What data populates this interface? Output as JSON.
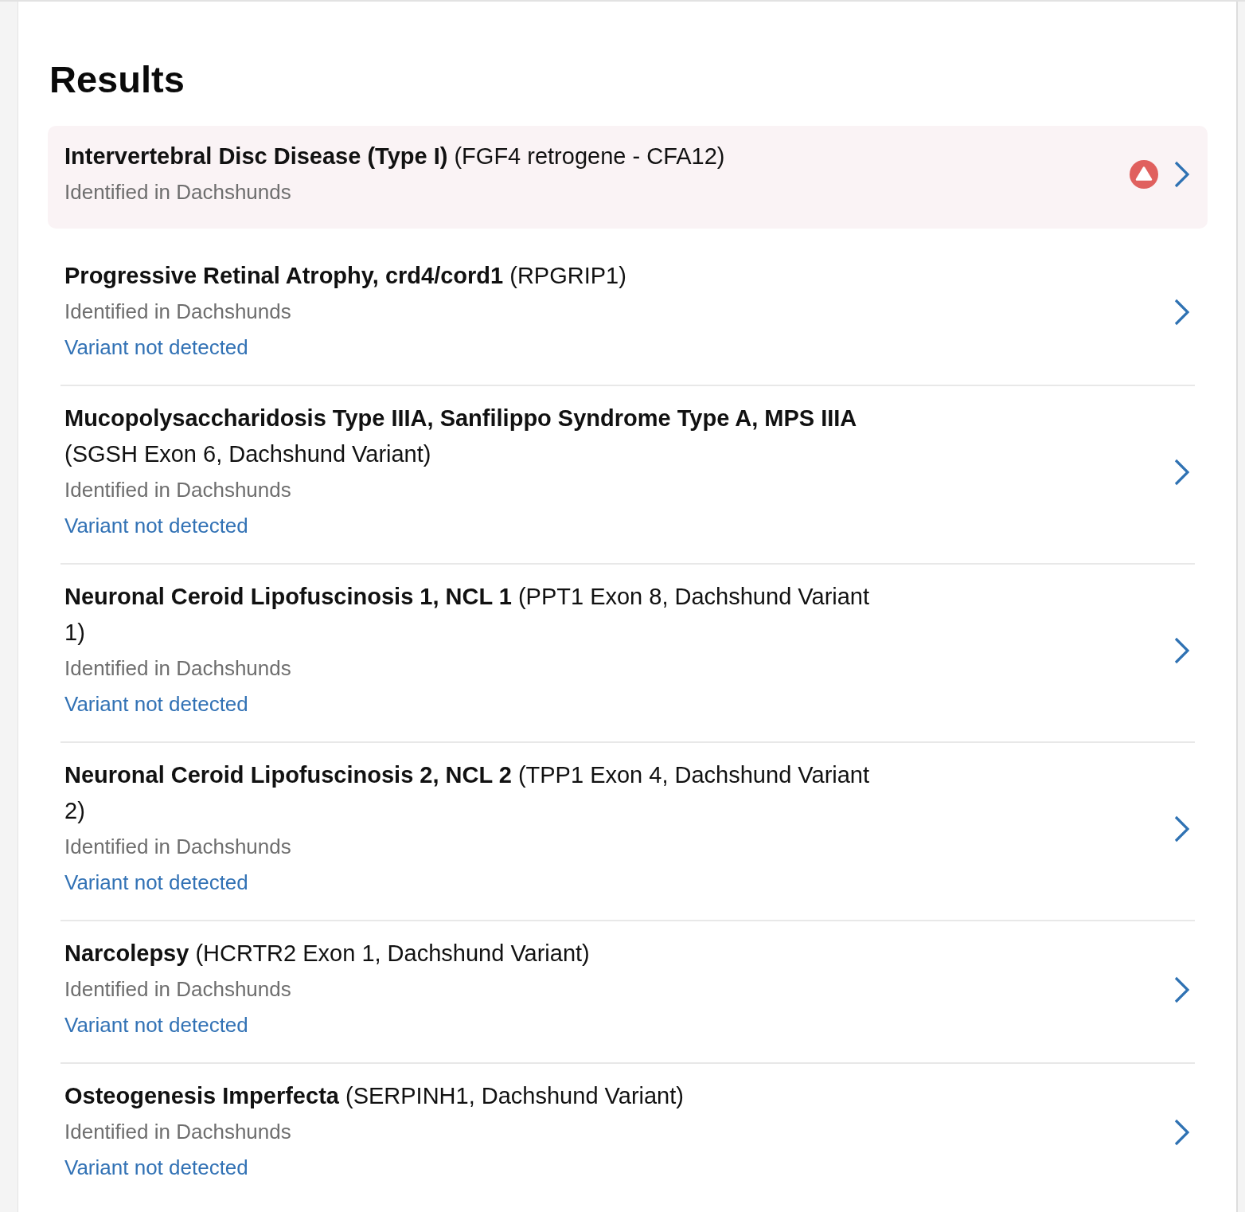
{
  "page": {
    "heading": "Results"
  },
  "results": [
    {
      "title": "**Intervertebral Disc Disease (Type I)** (FGF4 retrogene - CFA12)",
      "subtitle": "Identified in Dachshunds",
      "alert": true
    },
    {
      "title": "**Progressive Retinal Atrophy, crd4/cord1** (RPGRIP1)",
      "subtitle": "Identified in Dachshunds",
      "status": "Variant not detected",
      "alert": false
    },
    {
      "title": "**Mucopolysaccharidosis Type IIIA, Sanfilippo Syndrome Type A, MPS IIIA** (SGSH Exon 6, Dachshund Variant)",
      "subtitle": "Identified in Dachshunds",
      "status": "Variant not detected",
      "alert": false
    },
    {
      "title": "**Neuronal Ceroid Lipofuscinosis 1, NCL 1** (PPT1 Exon 8, Dachshund Variant 1)",
      "subtitle": "Identified in Dachshunds",
      "status": "Variant not detected",
      "alert": false
    },
    {
      "title": "**Neuronal Ceroid Lipofuscinosis 2, NCL 2** (TPP1 Exon 4, Dachshund Variant 2)",
      "subtitle": "Identified in Dachshunds",
      "status": "Variant not detected",
      "alert": false
    },
    {
      "title": "**Narcolepsy** (HCRTR2 Exon 1, Dachshund Variant)",
      "subtitle": "Identified in Dachshunds",
      "status": "Variant not detected",
      "alert": false
    },
    {
      "title": "**Osteogenesis Imperfecta** (SERPINH1, Dachshund Variant)",
      "subtitle": "Identified in Dachshunds",
      "status": "Variant not detected",
      "alert": false
    }
  ]
}
